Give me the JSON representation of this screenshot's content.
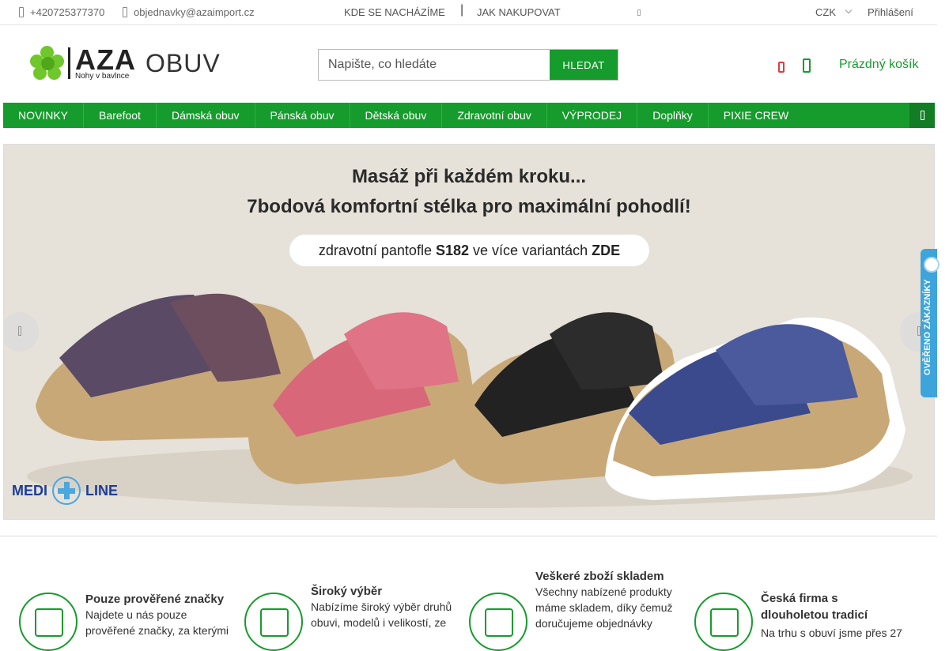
{
  "topbar": {
    "phone": "+420725377370",
    "email": "objednavky@azaimport.cz",
    "links": [
      "KDE SE NACHÁZÍME",
      "JAK NAKUPOVAT"
    ],
    "separator": "|",
    "currency": "CZK",
    "login": "Přihlášení"
  },
  "logo": {
    "brand": "AZA",
    "tagline": "Nohy v bavlnce",
    "suffix": "OBUV"
  },
  "search": {
    "placeholder": "Napište, co hledáte",
    "button": "HLEDAT"
  },
  "cart": {
    "label": "Prázdný košík"
  },
  "nav": {
    "items": [
      "NOVINKY",
      "Barefoot",
      "Dámská obuv",
      "Pánská obuv",
      "Dětská obuv",
      "Zdravotní obuv",
      "VÝPRODEJ",
      "Doplňky",
      "PIXIE CREW"
    ]
  },
  "hero": {
    "headline1": "Masáž při každém kroku...",
    "headline2": "7bodová komfortní stélka pro maximální pohodlí!",
    "pill_prefix": "zdravotní pantofle",
    "pill_model": "S182",
    "pill_middle": "ve více variantách",
    "pill_cta": "ZDE",
    "brand_left": "MEDI",
    "brand_right": "LINE"
  },
  "badge": {
    "text": "OVĚŘENO ZÁKAZNÍKY"
  },
  "features": [
    {
      "title": "Pouze prověřené značky",
      "desc": "Najdete u nás pouze prověřené značky, za kterými"
    },
    {
      "title": "Široký výběr",
      "desc": "Nabízíme široký výběr druhů obuvi, modelů i velikostí, ze"
    },
    {
      "title": "Veškeré zboží skladem",
      "desc": "Všechny nabízené produkty máme skladem, díky čemuž doručujeme objednávky"
    },
    {
      "title": "Česká firma s dlouholetou tradicí",
      "desc": "Na trhu s obuví jsme přes 27"
    }
  ],
  "colors": {
    "brand_green": "#169c2c",
    "heart_red": "#e23c3c",
    "badge_blue": "#3da5db"
  }
}
